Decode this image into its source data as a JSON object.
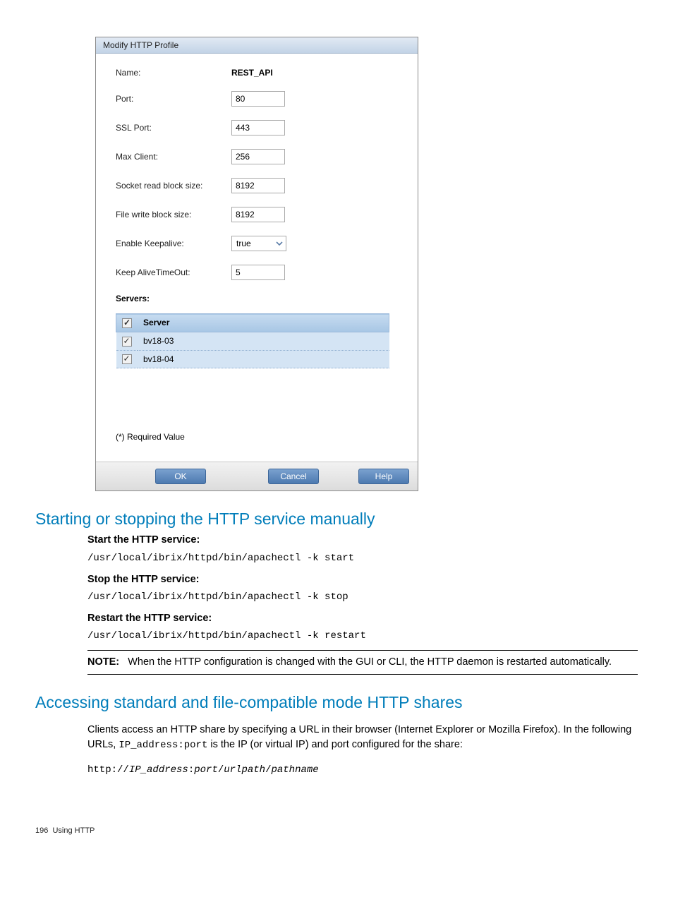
{
  "dialog": {
    "title": "Modify HTTP Profile",
    "fields": {
      "name_label": "Name:",
      "name_value": "REST_API",
      "port_label": "Port:",
      "port_value": "80",
      "sslport_label": "SSL Port:",
      "sslport_value": "443",
      "maxclient_label": "Max Client:",
      "maxclient_value": "256",
      "readblock_label": "Socket read block size:",
      "readblock_value": "8192",
      "writeblock_label": "File write block size:",
      "writeblock_value": "8192",
      "keepalive_label": "Enable Keepalive:",
      "keepalive_value": "true",
      "timeout_label": "Keep AliveTimeOut:",
      "timeout_value": "5"
    },
    "servers_heading": "Servers:",
    "server_col": "Server",
    "servers": [
      "bv18-03",
      "bv18-04"
    ],
    "required": "(*) Required Value",
    "buttons": {
      "ok": "OK",
      "cancel": "Cancel",
      "help": "Help"
    }
  },
  "section1": {
    "heading": "Starting or stopping the HTTP service manually",
    "start_h": "Start the HTTP service:",
    "start_cmd": "/usr/local/ibrix/httpd/bin/apachectl -k start",
    "stop_h": "Stop the HTTP service:",
    "stop_cmd": "/usr/local/ibrix/httpd/bin/apachectl -k stop",
    "restart_h": "Restart the HTTP service:",
    "restart_cmd": "/usr/local/ibrix/httpd/bin/apachectl -k restart",
    "note_label": "NOTE:",
    "note_text": "When the HTTP configuration is changed with the GUI or CLI, the HTTP daemon is restarted automatically."
  },
  "section2": {
    "heading": "Accessing standard and file-compatible mode HTTP shares",
    "para_a": "Clients access an HTTP share by specifying a URL in their browser (Internet Explorer or Mozilla Firefox). In the following URLs, ",
    "para_code": "IP_address:port",
    "para_b": " is the IP (or virtual IP) and port configured for the share:",
    "url_prefix": "http://",
    "url_ip": "IP_address",
    "url_sep1": ":",
    "url_port": "port",
    "url_sep2": "/",
    "url_path": "urlpath",
    "url_sep3": "/",
    "url_name": "pathname"
  },
  "footer": {
    "page": "196",
    "title": "Using HTTP"
  }
}
